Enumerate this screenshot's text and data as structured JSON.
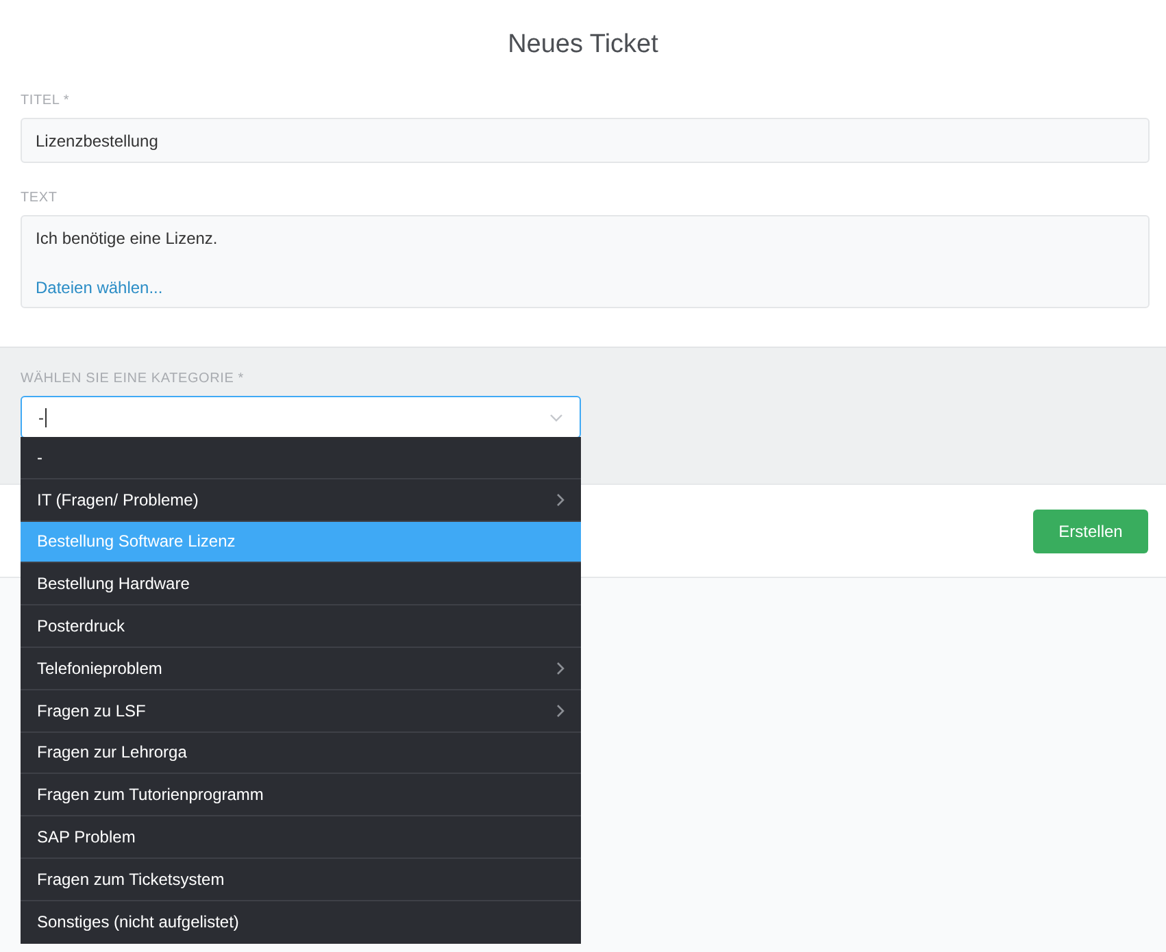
{
  "heading": "Neues Ticket",
  "title_field": {
    "label": "TITEL *",
    "value": "Lizenzbestellung"
  },
  "text_field": {
    "label": "TEXT",
    "value": "Ich benötige eine Lizenz.",
    "attach_link": "Dateien wählen..."
  },
  "category": {
    "label": "WÄHLEN SIE EINE KATEGORIE *",
    "value": "-",
    "expanded": true,
    "options": [
      {
        "label": "-",
        "highlighted": false,
        "has_children": false
      },
      {
        "label": "IT (Fragen/ Probleme)",
        "highlighted": false,
        "has_children": true
      },
      {
        "label": "Bestellung Software Lizenz",
        "highlighted": true,
        "has_children": false
      },
      {
        "label": "Bestellung Hardware",
        "highlighted": false,
        "has_children": false
      },
      {
        "label": "Posterdruck",
        "highlighted": false,
        "has_children": false
      },
      {
        "label": "Telefonieproblem",
        "highlighted": false,
        "has_children": true
      },
      {
        "label": "Fragen zu LSF",
        "highlighted": false,
        "has_children": true
      },
      {
        "label": "Fragen zur Lehrorga",
        "highlighted": false,
        "has_children": false
      },
      {
        "label": "Fragen zum Tutorienprogramm",
        "highlighted": false,
        "has_children": false
      },
      {
        "label": "SAP Problem",
        "highlighted": false,
        "has_children": false
      },
      {
        "label": "Fragen zum Ticketsystem",
        "highlighted": false,
        "has_children": false
      },
      {
        "label": "Sonstiges (nicht aufgelistet)",
        "highlighted": false,
        "has_children": false
      }
    ]
  },
  "submit_button": "Erstellen"
}
